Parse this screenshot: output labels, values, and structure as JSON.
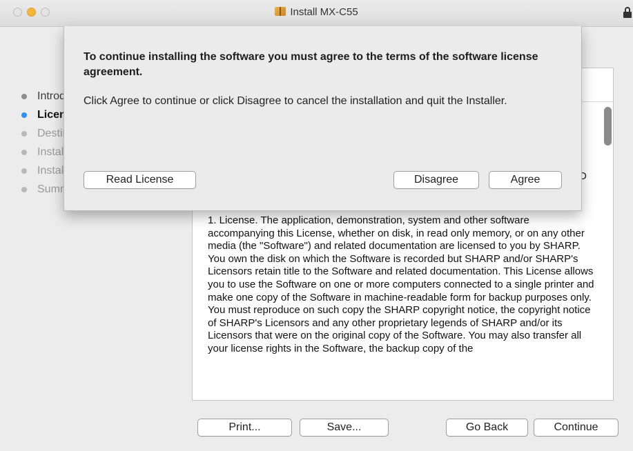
{
  "window": {
    "title": "Install MX-C55",
    "title_icon": "package-icon"
  },
  "steps": [
    {
      "label": "Introduction",
      "state": "done"
    },
    {
      "label": "License",
      "state": "active"
    },
    {
      "label": "Destination Select",
      "state": "pending"
    },
    {
      "label": "Installation Type",
      "state": "pending"
    },
    {
      "label": "Installation",
      "state": "pending"
    },
    {
      "label": "Summary",
      "state": "pending"
    }
  ],
  "license": {
    "cut_letter": "D",
    "text": "1. License.   The application, demonstration, system and other software accompanying this License, whether on disk, in read only memory, or on any other media (the \"Software\") and related documentation are licensed to you by SHARP.  You own the disk on which the Software is recorded but SHARP and/or SHARP's Licensors retain title to the Software and related documentation. This License allows you to use the Software on one or more computers connected to a single printer and make one copy of the Software in machine-readable form for backup purposes only.  You must reproduce on such copy the SHARP copyright notice, the copyright notice of SHARP's Licensors and any other proprietary legends of SHARP and/or its Licensors that were on the original copy of the Software. You may also transfer all your license rights in the Software, the backup copy of the"
  },
  "buttons": {
    "print": "Print...",
    "save": "Save...",
    "go_back": "Go Back",
    "continue": "Continue"
  },
  "dialog": {
    "heading": "To continue installing the software you must agree to the terms of the software license agreement.",
    "body": "Click Agree to continue or click Disagree to cancel the installation and quit the Installer.",
    "read_license": "Read License",
    "disagree": "Disagree",
    "agree": "Agree"
  },
  "colors": {
    "accent": "#2f8ff5",
    "minimize": "#f5b73b",
    "window_bg": "#ececec"
  }
}
